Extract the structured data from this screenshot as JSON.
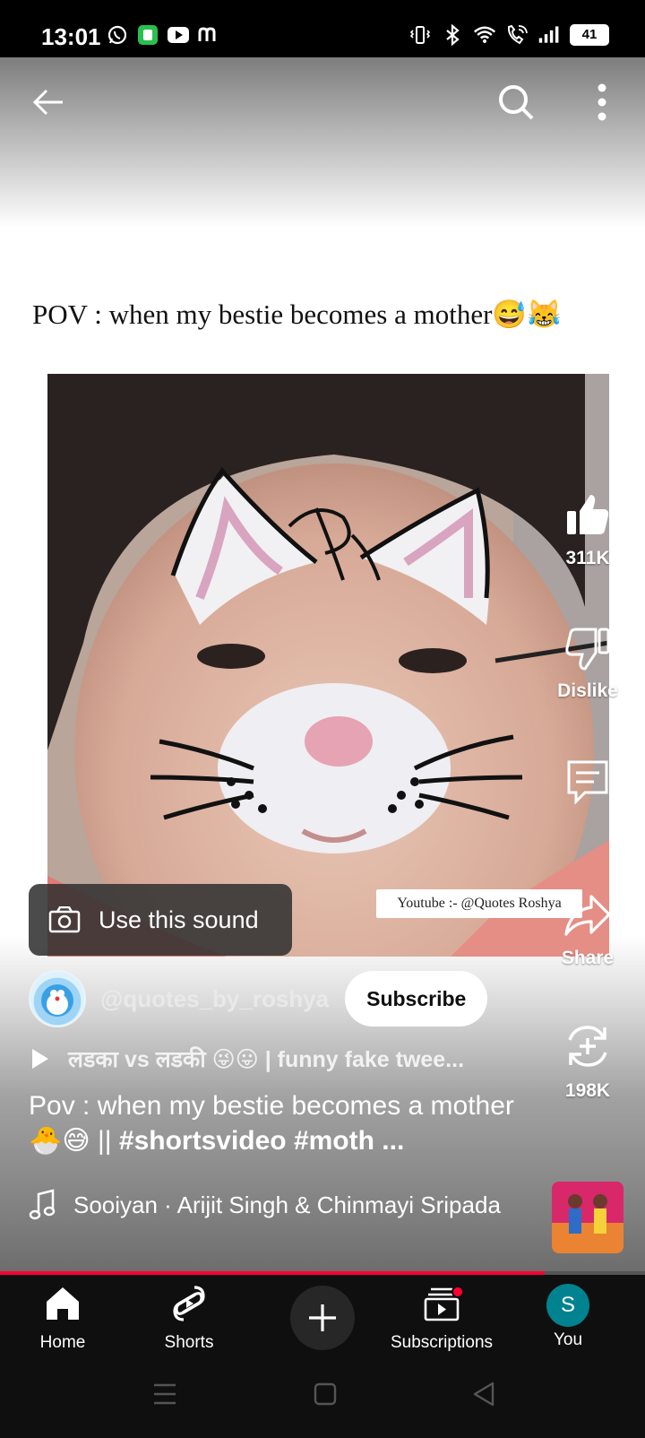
{
  "status_bar": {
    "time": "13:01",
    "battery": "41",
    "left_icons": [
      "whatsapp-icon",
      "app-icon",
      "youtube-icon",
      "m-icon"
    ],
    "right_icons": [
      "vibrate-icon",
      "bluetooth-icon",
      "wifi-icon",
      "wifi-call-icon",
      "signal-icon",
      "battery-icon"
    ]
  },
  "header": {
    "back_icon": "back-arrow-icon",
    "search_icon": "search-icon",
    "more_icon": "more-vert-icon"
  },
  "video": {
    "caption": "POV : when my bestie becomes a mother😅😹",
    "watermark": "Youtube :- @Quotes Roshya"
  },
  "use_sound": {
    "label": "Use this sound",
    "icon": "camera-icon"
  },
  "actions": {
    "like": {
      "label": "311K",
      "icon": "thumb-up-icon"
    },
    "dislike": {
      "label": "Dislike",
      "icon": "thumb-down-icon"
    },
    "comments": {
      "icon": "comment-icon"
    },
    "share": {
      "label": "Share",
      "icon": "share-icon"
    },
    "remix": {
      "label": "198K",
      "icon": "remix-icon"
    }
  },
  "channel": {
    "handle": "@quotes_by_roshya",
    "subscribe_label": "Subscribe"
  },
  "related": {
    "text": "लडका vs लडकी 😜😛 | funny fake twee..."
  },
  "title": {
    "plain": "Pov : when my bestie becomes a mother 🐣😅 || ",
    "hashtags": "#shortsvideo #moth ..."
  },
  "music": {
    "text": "Sooiyan · Arijit Singh & Chinmayi Sripada",
    "icon": "music-note-icon"
  },
  "progress": {
    "fraction": 0.845,
    "color": "#ff0033"
  },
  "bottom_nav": {
    "home": "Home",
    "shorts": "Shorts",
    "create_icon": "plus-icon",
    "subscriptions": "Subscriptions",
    "you": "You",
    "you_initial": "S"
  },
  "system_nav": [
    "menu-icon",
    "home-square-icon",
    "back-triangle-icon"
  ]
}
